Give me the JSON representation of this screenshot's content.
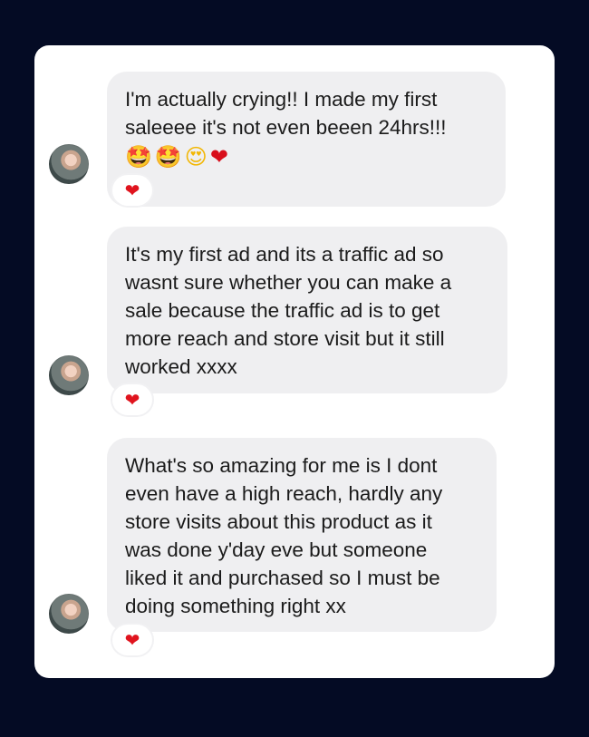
{
  "messages": [
    {
      "lines": [
        "I'm actually crying!! I made my first",
        "saleeee it's not even beeen 24hrs!!!"
      ],
      "emojis": [
        "🤩",
        "🤩",
        "😍",
        "❤"
      ],
      "reaction": "❤",
      "avatar_icon": "user-avatar"
    },
    {
      "lines": [
        "It's my first ad and its a traffic ad so",
        "wasnt sure whether you can make a",
        "sale because the traffic ad is to get",
        "more reach and store visit but it still",
        "worked xxxx"
      ],
      "emojis": [],
      "reaction": "❤",
      "avatar_icon": "user-avatar"
    },
    {
      "lines": [
        "What's so amazing for me is I dont",
        "even have a high reach, hardly any",
        "store visits about this product as it",
        "was done y'day eve but someone",
        "liked it and purchased so I must be",
        "doing something right xx"
      ],
      "emojis": [],
      "reaction": "❤",
      "avatar_icon": "user-avatar"
    }
  ],
  "colors": {
    "background": "#040b24",
    "card": "#ffffff",
    "bubble": "#efeff1",
    "text": "#1b1b1b",
    "heart": "#e0141e"
  }
}
